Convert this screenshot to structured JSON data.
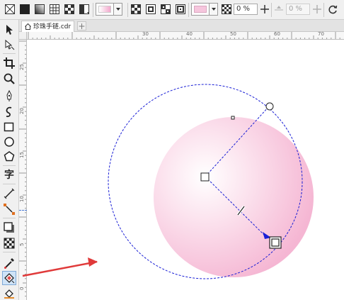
{
  "document": {
    "tab_title": "珍珠手链.cdr",
    "add_tab_symbol": "+"
  },
  "property_bar": {
    "fill_types": [
      "no-fill-icon",
      "uniform-fill-icon",
      "fountain-fill-icon",
      "vector-pattern-icon",
      "bitmap-pattern-icon",
      "two-color-pattern-icon"
    ],
    "node_transparency_value": "0 %",
    "midpoint_value": "0 %",
    "node_color": "#f6c6dd",
    "fill_picker_color_left": "#ffffff",
    "fill_picker_color_right": "#f2a8cc"
  },
  "rulers": {
    "top_labels": [
      "30",
      "40",
      "50",
      "60",
      "70"
    ],
    "left_labels": [
      "25",
      "20",
      "15",
      "10",
      "5",
      "0"
    ]
  },
  "colors": {
    "circle_center": "#ffffff",
    "circle_edge": "#f5b6d3",
    "guide_blue": "#1a1fd6",
    "arrow_red": "#e03a3a"
  },
  "tools": [
    "pick-tool-icon",
    "shape-tool-icon",
    "crop-tool-icon",
    "zoom-tool-icon",
    "freehand-tool-icon",
    "artistic-media-tool-icon",
    "rectangle-tool-icon",
    "ellipse-tool-icon",
    "polygon-tool-icon",
    "text-tool-icon",
    "parallel-dimension-tool-icon",
    "connector-tool-icon",
    "drop-shadow-tool-icon",
    "transparency-tool-icon",
    "color-eyedropper-tool-icon",
    "interactive-fill-tool-icon",
    "smart-fill-tool-icon"
  ]
}
